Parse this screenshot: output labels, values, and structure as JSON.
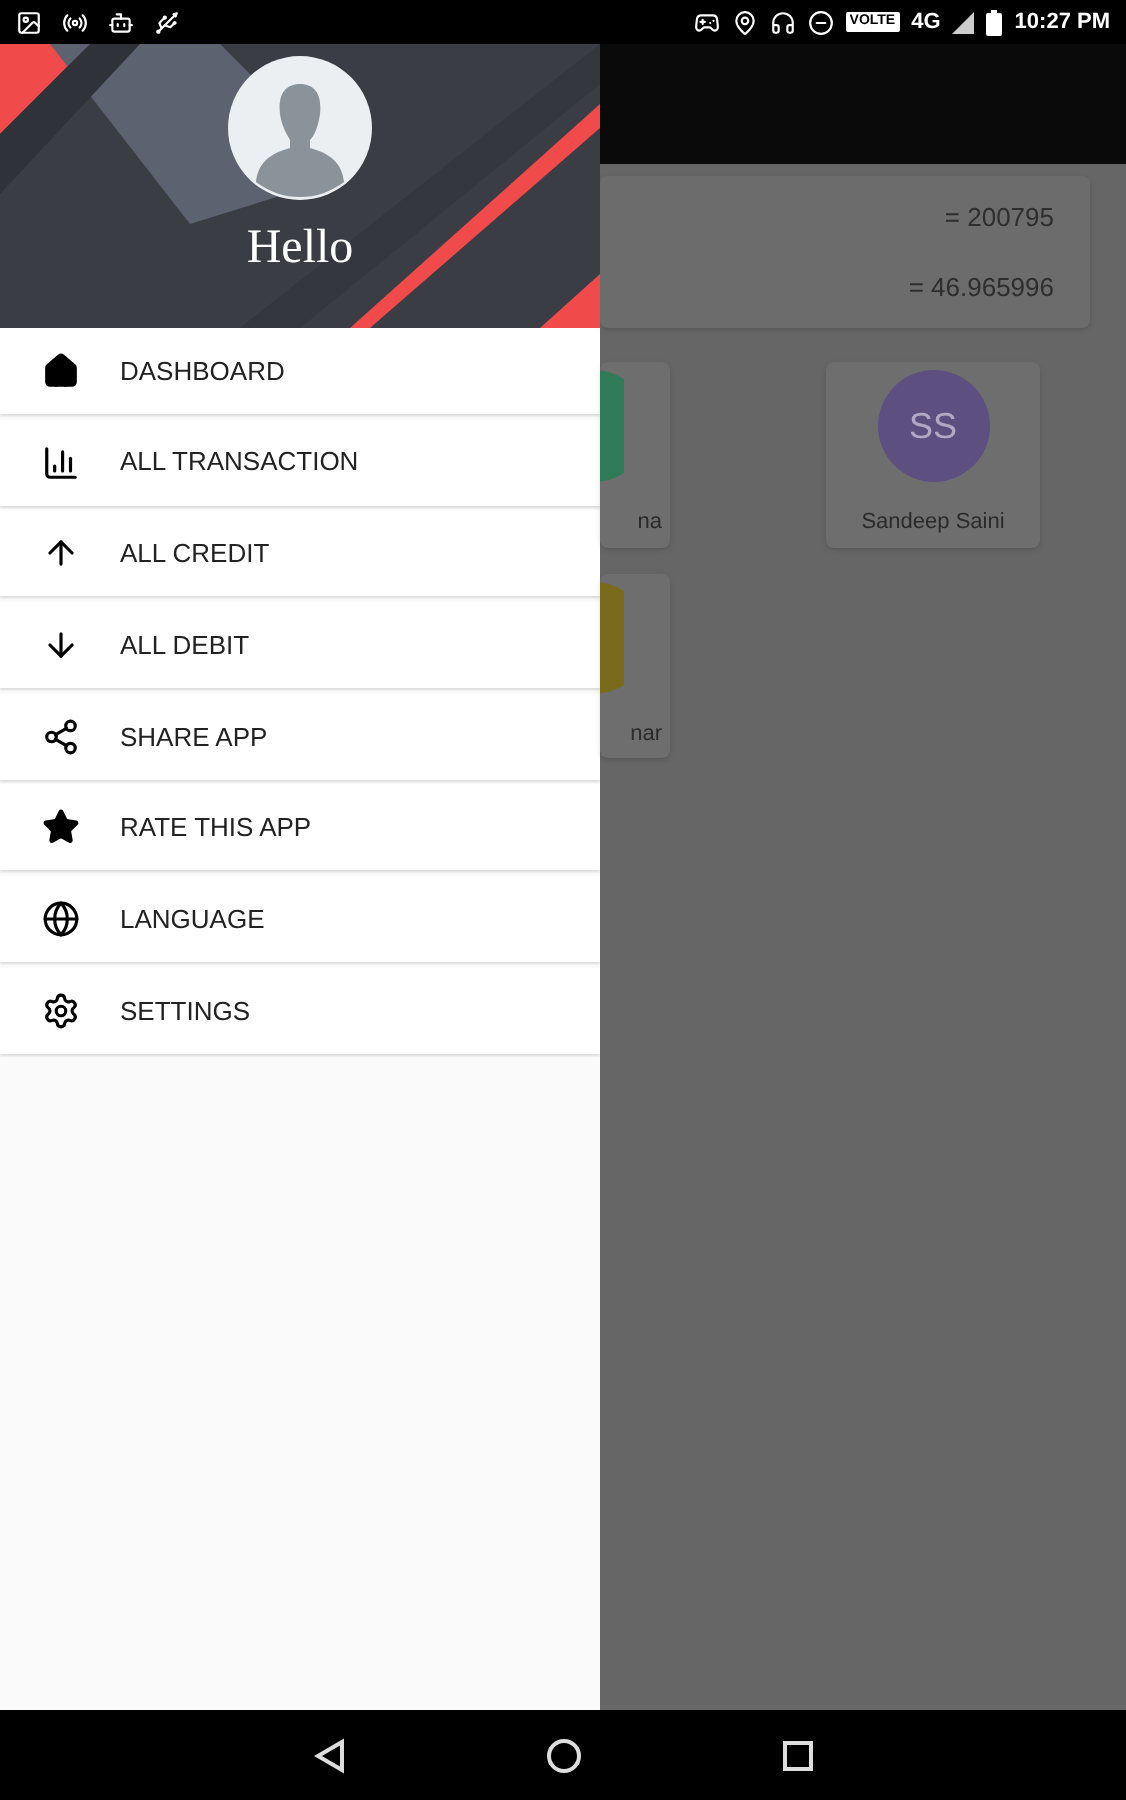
{
  "status_bar": {
    "volte": "VOLTE",
    "network": "4G",
    "time": "10:27 PM"
  },
  "drawer": {
    "greeting": "Hello",
    "items": [
      {
        "label": "DASHBOARD"
      },
      {
        "label": "ALL TRANSACTION"
      },
      {
        "label": "ALL CREDIT"
      },
      {
        "label": "ALL DEBIT"
      },
      {
        "label": "SHARE APP"
      },
      {
        "label": "RATE THIS APP"
      },
      {
        "label": "LANGUAGE"
      },
      {
        "label": "SETTINGS"
      }
    ]
  },
  "background": {
    "summary": [
      "= 200795",
      "= 46.965996"
    ],
    "contacts": [
      {
        "name": "na",
        "color": "#2f7a57"
      },
      {
        "initials": "SS",
        "name": "Sandeep Saini",
        "color": "#5d5080"
      },
      {
        "name": "nar",
        "color": "#7a6a1c"
      }
    ]
  }
}
